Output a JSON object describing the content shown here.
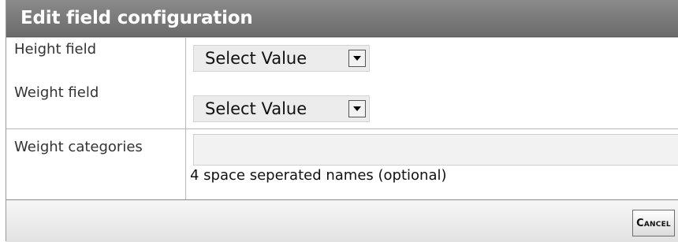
{
  "dialog": {
    "title": "Edit field configuration"
  },
  "fields": {
    "height": {
      "label": "Height field",
      "select_value": "Select Value"
    },
    "weight": {
      "label": "Weight field",
      "select_value": "Select Value"
    },
    "categories": {
      "label": "Weight categories",
      "value": "",
      "hint": "4 space seperated names (optional)"
    }
  },
  "footer": {
    "cancel_label": "Cancel"
  }
}
